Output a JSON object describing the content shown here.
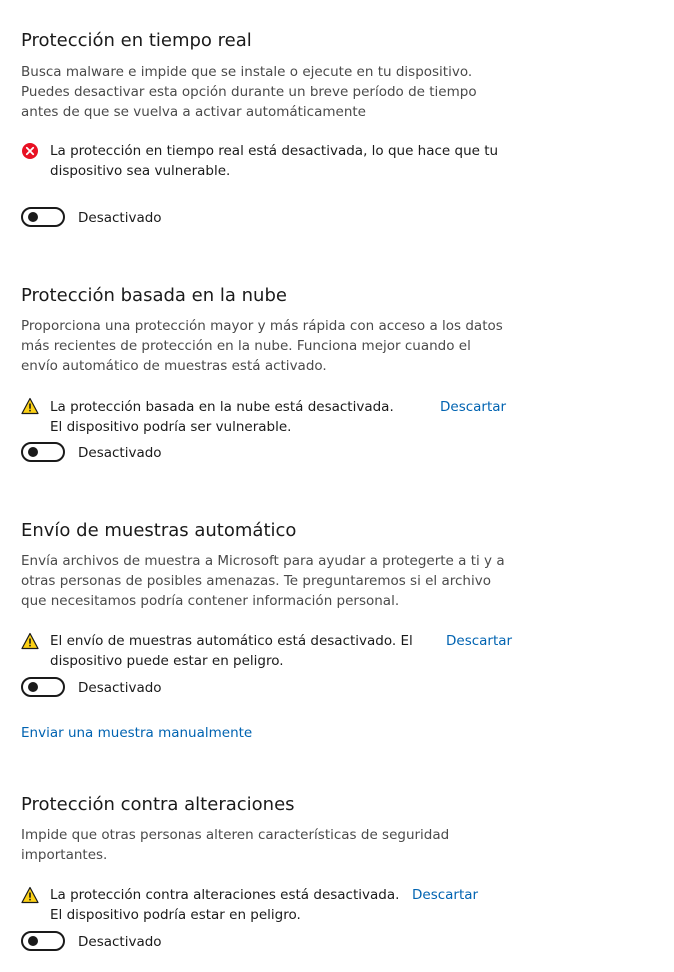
{
  "realtime": {
    "title": "Protección en tiempo real",
    "description": "Busca malware e impide que se instale o ejecute en tu dispositivo. Puedes desactivar esta opción durante un breve período de tiempo antes de que se vuelva a activar automáticamente",
    "alert_icon": "error-icon",
    "alert_color": "#e81123",
    "alert_text": "La protección en tiempo real está desactivada, lo que hace que tu dispositivo sea vulnerable.",
    "toggle_state": "Desactivado"
  },
  "cloud": {
    "title": "Protección basada en la nube",
    "description": "Proporciona una protección mayor y más rápida con acceso a los datos más recientes de protección en la nube. Funciona mejor cuando el envío automático de muestras está activado.",
    "alert_icon": "warning-icon",
    "alert_color": "#fcd116",
    "alert_text": "La protección basada en la nube está desactivada. El dispositivo podría ser vulnerable.",
    "dismiss_label": "Descartar",
    "toggle_state": "Desactivado"
  },
  "sample": {
    "title": "Envío de muestras automático",
    "description": "Envía archivos de muestra a Microsoft para ayudar a protegerte a ti y a otras personas de posibles amenazas. Te preguntaremos si el archivo que necesitamos podría contener información personal.",
    "alert_icon": "warning-icon",
    "alert_text": "El envío de muestras automático está desactivado. El dispositivo puede estar en peligro.",
    "dismiss_label": "Descartar",
    "toggle_state": "Desactivado",
    "manual_link": "Enviar una muestra manualmente"
  },
  "tamper": {
    "title": "Protección contra alteraciones",
    "description": "Impide que otras personas alteren características de seguridad importantes.",
    "alert_icon": "warning-icon",
    "alert_text": "La protección contra alteraciones está desactivada. El dispositivo podría estar en peligro.",
    "dismiss_label": "Descartar",
    "toggle_state": "Desactivado"
  },
  "colors": {
    "link": "#0063b1",
    "error": "#e81123",
    "warning": "#fcd116"
  }
}
